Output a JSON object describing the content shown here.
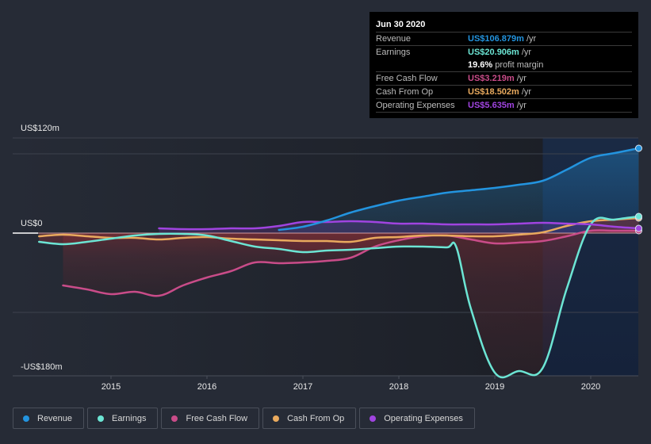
{
  "tooltip": {
    "date": "Jun 30 2020",
    "rows": [
      {
        "label": "Revenue",
        "value": "US$106.879m",
        "unit": "/yr",
        "color": "#2394df"
      },
      {
        "label": "Earnings",
        "value": "US$20.906m",
        "unit": "/yr",
        "color": "#6ce5d4"
      },
      {
        "label": "",
        "value": "19.6%",
        "unit": "profit margin",
        "color": "#ffffff"
      },
      {
        "label": "Free Cash Flow",
        "value": "US$3.219m",
        "unit": "/yr",
        "color": "#c94c89"
      },
      {
        "label": "Cash From Op",
        "value": "US$18.502m",
        "unit": "/yr",
        "color": "#e9aa5e"
      },
      {
        "label": "Operating Expenses",
        "value": "US$5.635m",
        "unit": "/yr",
        "color": "#a044e0"
      }
    ]
  },
  "legend": [
    {
      "label": "Revenue",
      "color": "#2394df"
    },
    {
      "label": "Earnings",
      "color": "#6ce5d4"
    },
    {
      "label": "Free Cash Flow",
      "color": "#c94c89"
    },
    {
      "label": "Cash From Op",
      "color": "#e9aa5e"
    },
    {
      "label": "Operating Expenses",
      "color": "#a044e0"
    }
  ],
  "chart_data": {
    "type": "line",
    "title": "",
    "xlabel": "",
    "ylabel": "",
    "y_tick_labels": [
      "US$120m",
      "US$0",
      "-US$180m"
    ],
    "y_ticks": [
      120,
      0,
      -180
    ],
    "ylim": [
      -180,
      120
    ],
    "xlim": [
      2014.25,
      2020.5
    ],
    "x_tick_labels": [
      "2015",
      "2016",
      "2017",
      "2018",
      "2019",
      "2020"
    ],
    "x_ticks": [
      2015,
      2016,
      2017,
      2018,
      2019,
      2020
    ],
    "highlight_range": [
      2019.5,
      2020.5
    ],
    "grid": true,
    "legend_position": "bottom-left",
    "series": [
      {
        "name": "Revenue",
        "color": "#2394df",
        "x": [
          2016.75,
          2017.0,
          2017.25,
          2017.5,
          2017.75,
          2018.0,
          2018.25,
          2018.5,
          2018.75,
          2019.0,
          2019.25,
          2019.5,
          2019.75,
          2020.0,
          2020.25,
          2020.5
        ],
        "values": [
          4,
          8,
          16,
          26,
          34,
          41,
          46,
          51,
          54,
          57,
          61,
          66,
          80,
          95,
          101,
          107
        ]
      },
      {
        "name": "Earnings",
        "color": "#6ce5d4",
        "x": [
          2014.25,
          2014.5,
          2014.75,
          2015.0,
          2015.25,
          2015.5,
          2015.75,
          2016.0,
          2016.25,
          2016.5,
          2016.75,
          2017.0,
          2017.25,
          2017.5,
          2017.75,
          2018.0,
          2018.25,
          2018.5,
          2018.6,
          2018.75,
          2019.0,
          2019.25,
          2019.5,
          2019.75,
          2020.0,
          2020.25,
          2020.5
        ],
        "values": [
          -11,
          -14,
          -11,
          -7,
          -3,
          -1,
          -1,
          -3,
          -10,
          -17,
          -20,
          -24,
          -22,
          -21,
          -19,
          -17,
          -17,
          -18,
          -18,
          -95,
          -176,
          -174,
          -170,
          -70,
          11,
          17,
          21
        ]
      },
      {
        "name": "Free Cash Flow",
        "color": "#c94c89",
        "x": [
          2014.5,
          2014.75,
          2015.0,
          2015.25,
          2015.5,
          2015.75,
          2016.0,
          2016.25,
          2016.5,
          2016.75,
          2017.0,
          2017.25,
          2017.5,
          2017.75,
          2018.0,
          2018.25,
          2018.5,
          2018.75,
          2019.0,
          2019.25,
          2019.5,
          2019.75,
          2020.0,
          2020.25,
          2020.5
        ],
        "values": [
          -66,
          -71,
          -77,
          -74,
          -79,
          -66,
          -56,
          -48,
          -37,
          -38,
          -37,
          -35,
          -31,
          -17,
          -9,
          -4,
          -3,
          -8,
          -13,
          -12,
          -10,
          -4,
          3,
          3,
          3
        ]
      },
      {
        "name": "Cash From Op",
        "color": "#e9aa5e",
        "x": [
          2014.25,
          2014.5,
          2014.75,
          2015.0,
          2015.25,
          2015.5,
          2015.75,
          2016.0,
          2016.25,
          2016.5,
          2016.75,
          2017.0,
          2017.25,
          2017.5,
          2017.75,
          2018.0,
          2018.25,
          2018.5,
          2018.75,
          2019.0,
          2019.25,
          2019.5,
          2019.75,
          2020.0,
          2020.25,
          2020.5
        ],
        "values": [
          -4,
          -2,
          -4,
          -6,
          -6,
          -8,
          -6,
          -5,
          -7,
          -8,
          -9,
          -10,
          -10,
          -11,
          -6,
          -5,
          -3,
          -3,
          -4,
          -4,
          -2,
          1,
          9,
          15,
          17,
          19
        ]
      },
      {
        "name": "Operating Expenses",
        "color": "#a044e0",
        "x": [
          2015.5,
          2015.75,
          2016.0,
          2016.25,
          2016.5,
          2016.75,
          2017.0,
          2017.25,
          2017.5,
          2017.75,
          2018.0,
          2018.25,
          2018.5,
          2018.75,
          2019.0,
          2019.25,
          2019.5,
          2019.75,
          2020.0,
          2020.25,
          2020.5
        ],
        "values": [
          6,
          5,
          5,
          6,
          6,
          9,
          14,
          14,
          15,
          14,
          12,
          12,
          11,
          11,
          11,
          12,
          13,
          12,
          11,
          8,
          6
        ]
      }
    ]
  }
}
